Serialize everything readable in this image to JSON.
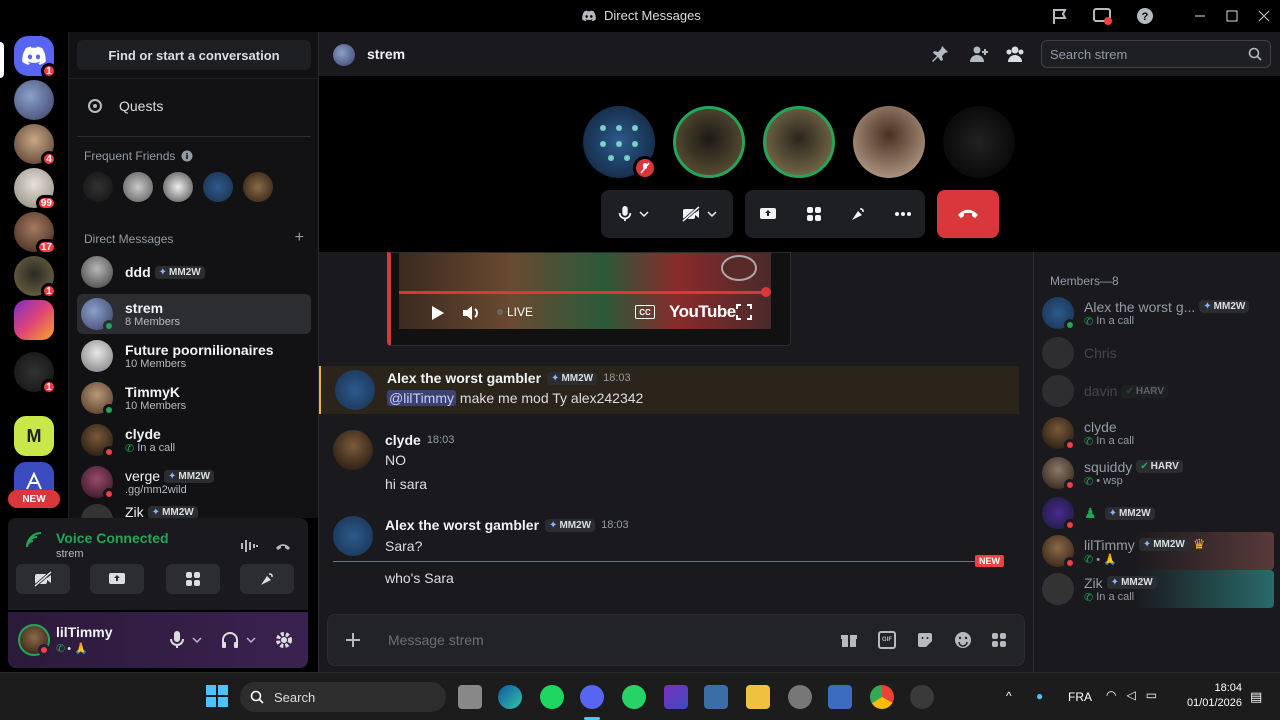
{
  "window": {
    "title": "Direct Messages"
  },
  "servers": [
    {
      "badge": "1"
    },
    {
      "badge": ""
    },
    {
      "badge": "4"
    },
    {
      "badge": "99"
    },
    {
      "badge": "17"
    },
    {
      "badge": "1"
    },
    {
      "badge": ""
    },
    {
      "badge": "1"
    },
    {
      "badge": ""
    },
    {
      "badge": "NEW"
    }
  ],
  "sidebar": {
    "search_label": "Find or start a conversation",
    "quests_label": "Quests",
    "frequent_friends_label": "Frequent Friends",
    "dm_header": "Direct Messages",
    "dms": [
      {
        "name": "ddd",
        "tag": "MM2W",
        "sub": ""
      },
      {
        "name": "strem",
        "tag": "",
        "sub": "8 Members"
      },
      {
        "name": "Future poornilionaires",
        "tag": "",
        "sub": "10 Members"
      },
      {
        "name": "TimmyK",
        "tag": "",
        "sub": "10 Members"
      },
      {
        "name": "clyde",
        "tag": "",
        "sub": "In a call"
      },
      {
        "name": "verge",
        "tag": "MM2W",
        "sub": ".gg/mm2wild"
      },
      {
        "name": "Zik",
        "tag": "MM2W",
        "sub": ""
      }
    ]
  },
  "voice": {
    "status": "Voice Connected",
    "channel": "strem"
  },
  "user": {
    "name": "lilTimmy",
    "status": "• 🙏"
  },
  "channel": {
    "name": "strem",
    "search_placeholder": "Search strem"
  },
  "video": {
    "live_label": "LIVE",
    "youtube_label": "YouTube"
  },
  "messages": [
    {
      "author": "Alex the worst gambler",
      "tag": "MM2W",
      "time": "18:03",
      "mention": "@lilTimmy",
      "text": " make me mod Ty alex242342"
    },
    {
      "author": "clyde",
      "tag": "",
      "time": "18:03",
      "lines": [
        "NO",
        "hi sara"
      ]
    },
    {
      "author": "Alex the worst gambler",
      "tag": "MM2W",
      "time": "18:03",
      "lines": [
        "Sara?"
      ]
    },
    {
      "new_label": "NEW",
      "lines": [
        "who's Sara"
      ]
    }
  ],
  "composer": {
    "placeholder": "Message strem"
  },
  "members": {
    "header": "Members—8",
    "list": [
      {
        "name": "Alex the worst g...",
        "tag": "MM2W",
        "sub": "In a call"
      },
      {
        "name": "Chris",
        "tag": "",
        "sub": ""
      },
      {
        "name": "davin",
        "tag": "HARV",
        "sub": ""
      },
      {
        "name": "clyde",
        "tag": "",
        "sub": "In a call"
      },
      {
        "name": "squiddy",
        "tag": "HARV",
        "sub": "• wsp"
      },
      {
        "name": "",
        "tag": "MM2W",
        "sub": ""
      },
      {
        "name": "lilTimmy",
        "tag": "MM2W",
        "sub": "• 🙏"
      },
      {
        "name": "Zik",
        "tag": "MM2W",
        "sub": "In a call"
      }
    ]
  },
  "taskbar": {
    "search_label": "Search",
    "lang": "FRA",
    "time": "18:04",
    "date": "01/01/2026"
  },
  "colors": {
    "accent": "#5865f2",
    "danger": "#da373c",
    "online": "#23a55a",
    "dnd": "#f23f43"
  }
}
